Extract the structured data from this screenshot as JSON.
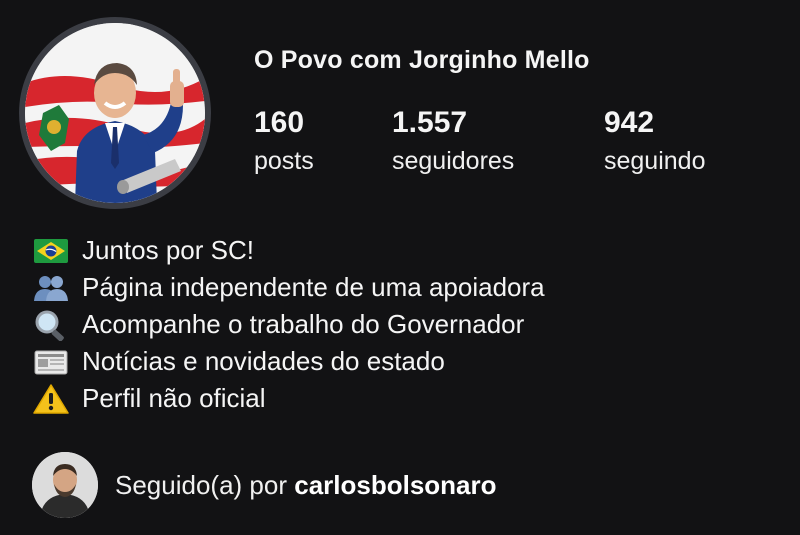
{
  "profile": {
    "name": "O Povo com Jorginho Mello",
    "avatar_icon": "profile-photo-governor-thumbs-up"
  },
  "stats": {
    "posts": {
      "value": "160",
      "label": "posts"
    },
    "followers": {
      "value": "1.557",
      "label": "seguidores"
    },
    "following": {
      "value": "942",
      "label": "seguindo"
    }
  },
  "bio": [
    {
      "icon": "brazil-flag-icon",
      "text": "Juntos por SC!"
    },
    {
      "icon": "people-icon",
      "text": "Página independente de uma apoiadora"
    },
    {
      "icon": "magnifier-icon",
      "text": "Acompanhe o trabalho do Governador"
    },
    {
      "icon": "newspaper-icon",
      "text": "Notícias e novidades do estado"
    },
    {
      "icon": "warning-icon",
      "text": "Perfil não oficial"
    }
  ],
  "followed_by": {
    "prefix": "Seguido(a) por",
    "username": "carlosbolsonaro"
  },
  "colors": {
    "background": "#121214",
    "text": "#f5f5f5",
    "ring": "#3b3d44"
  }
}
